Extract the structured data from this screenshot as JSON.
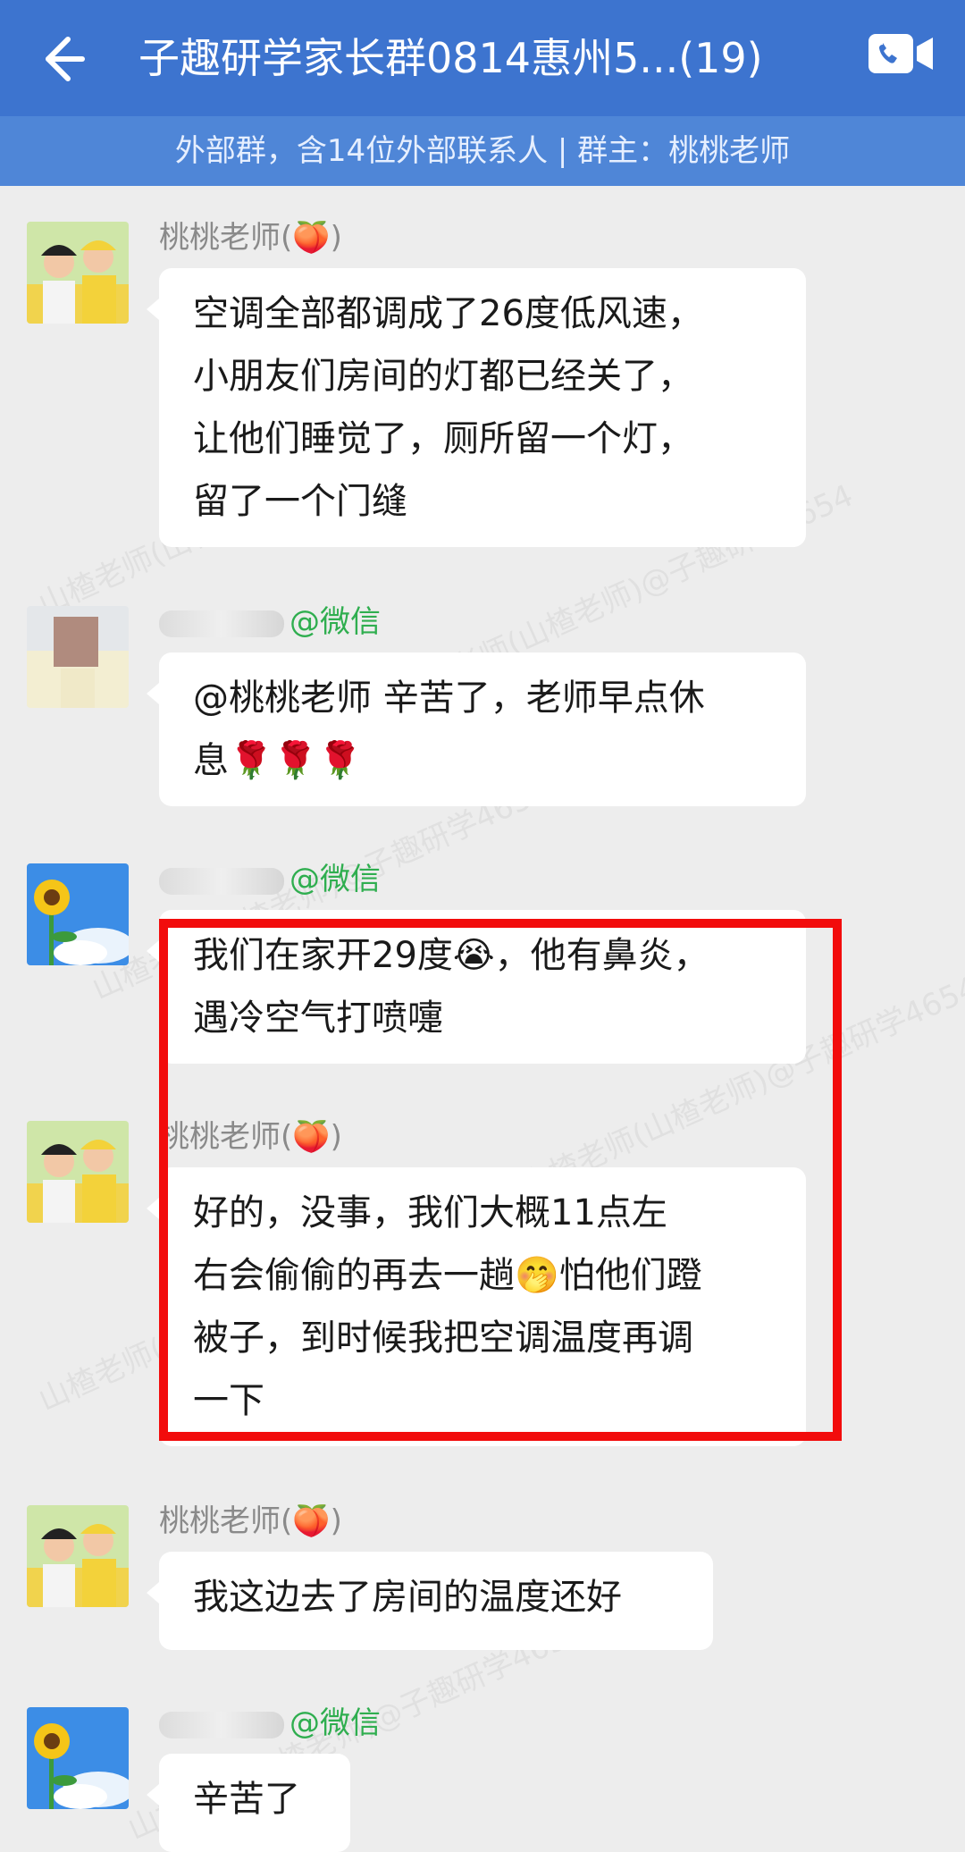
{
  "header": {
    "title": "子趣研学家长群0814惠州5...(19)",
    "subtitle": "外部群，含14位外部联系人 | 群主：桃桃老师"
  },
  "colors": {
    "header_bg": "#3d74cf",
    "subheader_bg": "#4f86d7",
    "wechat_tag": "#2fae4f",
    "highlight": "#f20c0c"
  },
  "messages": [
    {
      "sender": "桃桃老师(🍑)",
      "avatar": "teacher-photo",
      "lines": [
        "空调全部都调成了26度低风速，",
        "小朋友们房间的灯都已经关了，",
        "让他们睡觉了，厕所留一个灯，",
        "留了一个门缝"
      ]
    },
    {
      "sender_tag": "@微信",
      "avatar": "blurred-photo",
      "lines": [
        "@桃桃老师 辛苦了，老师早点休",
        "息🌹🌹🌹"
      ]
    },
    {
      "sender_tag": "@微信",
      "avatar": "sunflower-photo",
      "lines": [
        "我们在家开29度😭，他有鼻炎，",
        "遇冷空气打喷嚏"
      ]
    },
    {
      "sender": "桃桃老师(🍑)",
      "avatar": "teacher-photo",
      "lines": [
        "好的，没事，我们大概11点左",
        "右会偷偷的再去一趟🤭怕他们蹬",
        "被子，到时候我把空调温度再调",
        "一下"
      ]
    },
    {
      "sender": "桃桃老师(🍑)",
      "avatar": "teacher-photo",
      "lines": [
        "我这边去了房间的温度还好"
      ]
    },
    {
      "sender_tag": "@微信",
      "avatar": "sunflower-photo",
      "lines": [
        "辛苦了"
      ]
    }
  ],
  "watermarks": [
    "山楂老师(山楂老师)@子趣研学4654"
  ]
}
